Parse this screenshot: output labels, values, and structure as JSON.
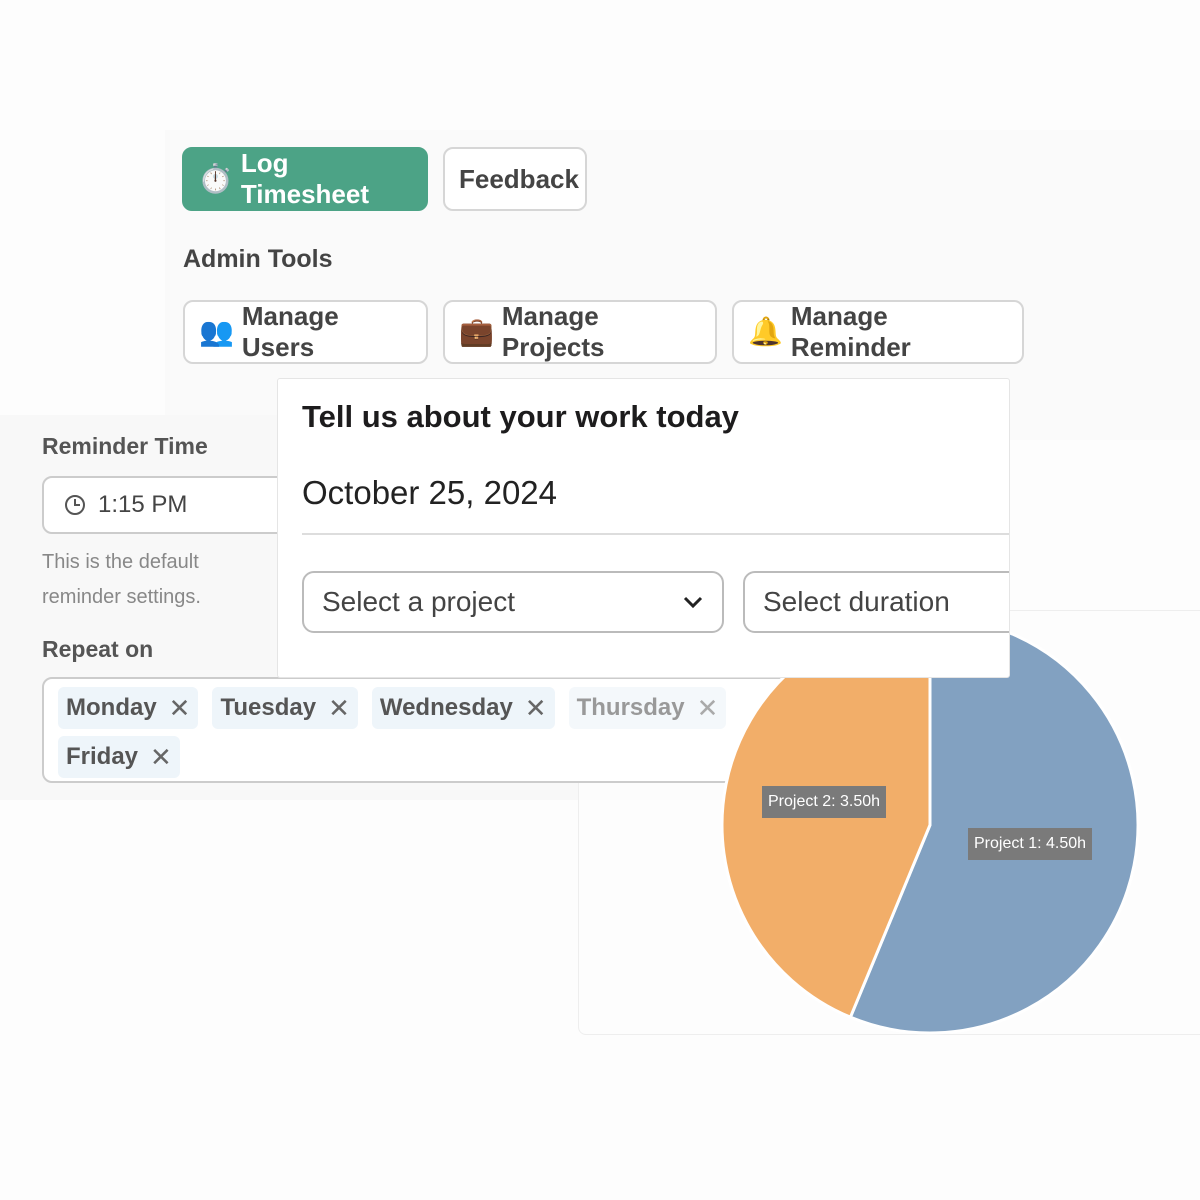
{
  "toolbar": {
    "log_timesheet": "Log Timesheet",
    "log_icon": "stopwatch-icon",
    "feedback": "Feedback"
  },
  "admin": {
    "title": "Admin Tools",
    "buttons": [
      {
        "label": "Manage Users",
        "icon": "users-icon"
      },
      {
        "label": "Manage Projects",
        "icon": "briefcase-icon"
      },
      {
        "label": "Manage Reminder",
        "icon": "bell-icon"
      }
    ]
  },
  "reminder": {
    "time_label": "Reminder Time",
    "time_value": "1:15 PM",
    "hint": "This is the default reminder settings.",
    "hint_line1": "This is the default reminde",
    "hint_line2": "settings.",
    "repeat_label": "Repeat on",
    "days": [
      "Monday",
      "Tuesday",
      "Wednesday",
      "Thursday",
      "Friday"
    ]
  },
  "form": {
    "title": "Tell us about your work today",
    "date": "October 25, 2024",
    "project_placeholder": "Select a project",
    "duration_placeholder": "Select duration"
  },
  "chart_data": {
    "type": "pie",
    "series": [
      {
        "name": "Project 1",
        "value": 4.5,
        "label": "Project 1: 4.50h",
        "color": "#82a1c1"
      },
      {
        "name": "Project 2",
        "value": 3.5,
        "label": "Project 2: 3.50h",
        "color": "#f2ae69"
      }
    ]
  }
}
